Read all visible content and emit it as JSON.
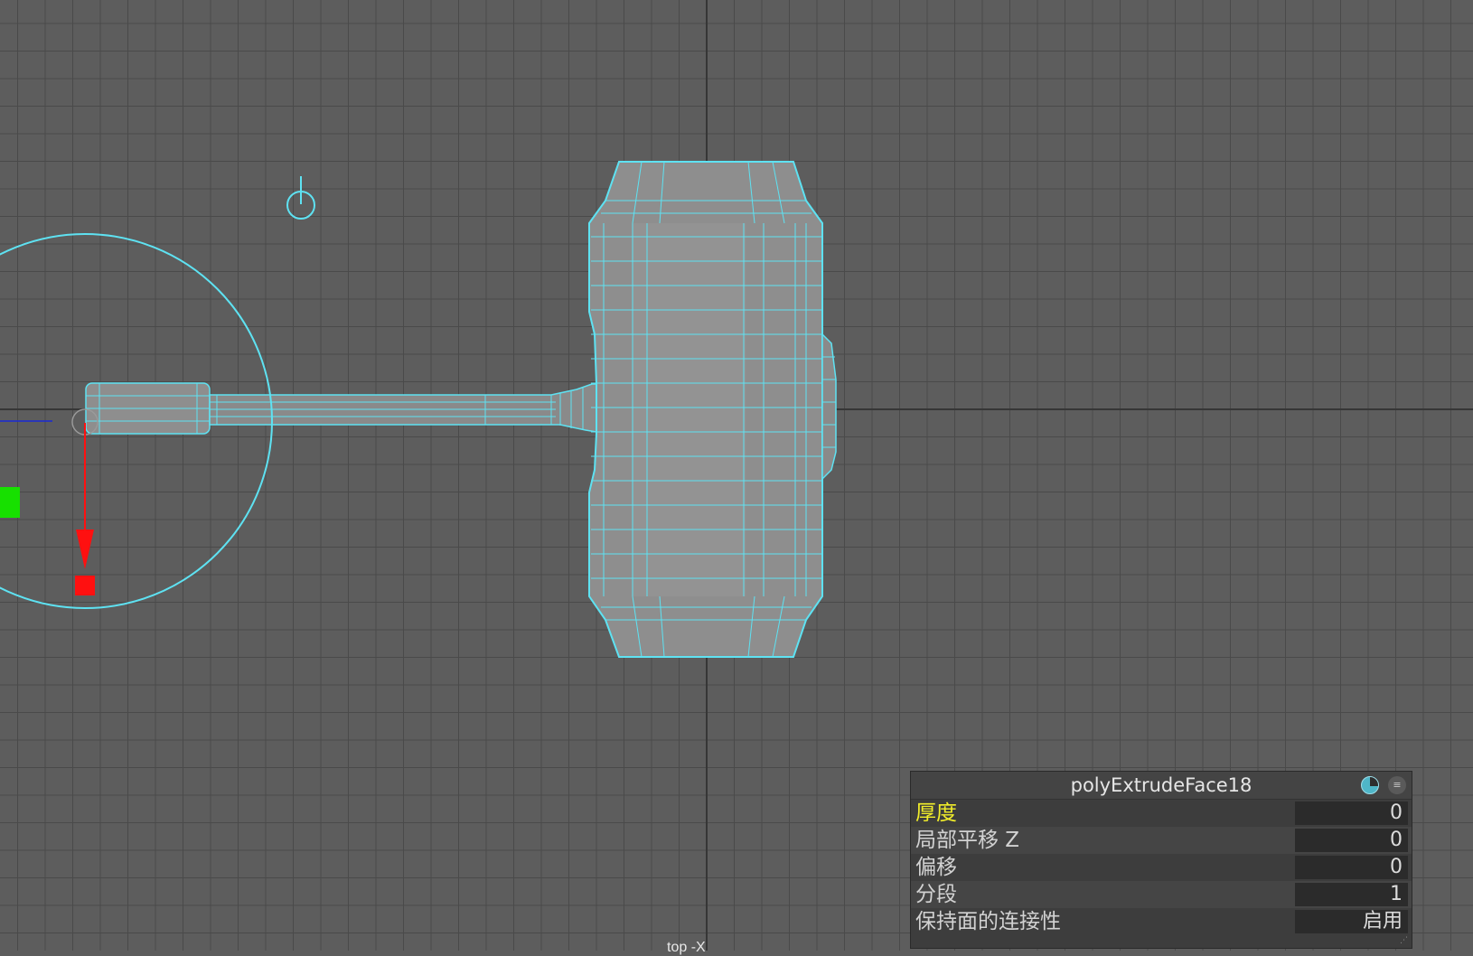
{
  "viewport": {
    "camera_label": "top -X",
    "background": "#5d5d5d",
    "grid_color": "#4a4a4a",
    "axis_color": "#363636",
    "wire_color": "#5ee2f2",
    "shade_color": "#8e8e8e"
  },
  "manipulator": {
    "x_axis_color": "#ff1010",
    "y_axis_color": "#17e000",
    "z_axis_color": "#1a2ad6",
    "ring_color": "#5ee2f2",
    "icons": [
      "rotate-ring-icon",
      "pivot-icon"
    ]
  },
  "hud": {
    "title": "polyExtrudeFace18",
    "icon": "channel-box-icon",
    "menu_icon": "hud-menu-icon",
    "rows": [
      {
        "label": "厚度",
        "value": "0",
        "active": true
      },
      {
        "label": "局部平移 Z",
        "value": "0"
      },
      {
        "label": "偏移",
        "value": "0"
      },
      {
        "label": "分段",
        "value": "1"
      },
      {
        "label": "保持面的连接性",
        "value": "启用"
      }
    ]
  }
}
